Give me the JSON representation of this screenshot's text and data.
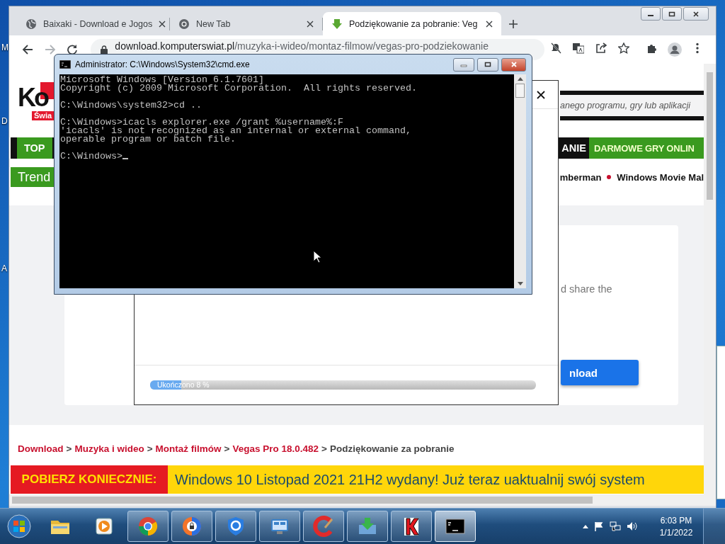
{
  "desktop": {
    "icon_labels": [
      "M",
      "D",
      "A"
    ]
  },
  "browser": {
    "tabs": [
      {
        "title": "Baixaki - Download e Jogos",
        "kind": "globe",
        "selected": false
      },
      {
        "title": "New Tab",
        "kind": "chrome",
        "selected": false
      },
      {
        "title": "Podziękowanie za pobranie: Veg",
        "kind": "download",
        "selected": true
      }
    ],
    "address": {
      "domain": "download.komputerswiat.pl",
      "path": "/muzyka-i-wideo/montaz-filmow/vegas-pro-podziekowanie"
    },
    "page": {
      "logo": {
        "text": "Ko",
        "subtext": "Świa"
      },
      "search_hint": "anego programu, gry lub aplikacji",
      "nav": [
        {
          "label": "TOP",
          "kind": "green"
        },
        {
          "label": "ANIE",
          "kind": "dark"
        },
        {
          "label": "DARMOWE GRY ONLIN",
          "kind": "green"
        }
      ],
      "trending": {
        "label": "Trend",
        "items": [
          "mberman",
          "Windows Movie Mal"
        ]
      },
      "card": {
        "text": "d share the",
        "button": "nload"
      },
      "breadcrumb": [
        {
          "label": "Download",
          "kind": "link"
        },
        {
          "label": ">",
          "kind": "separator"
        },
        {
          "label": "Muzyka i wideo",
          "kind": "link"
        },
        {
          "label": ">",
          "kind": "separator"
        },
        {
          "label": "Montaż filmów",
          "kind": "link"
        },
        {
          "label": ">",
          "kind": "separator"
        },
        {
          "label": "Vegas Pro 18.0.482",
          "kind": "link"
        },
        {
          "label": ">",
          "kind": "separator"
        },
        {
          "label": "Podziękowanie za pobranie",
          "kind": "current"
        }
      ],
      "banner": {
        "label": "POBIERZ KONIECZNIE:",
        "text": "Windows 10 Listopad 2021 21H2 wydany! Już teraz uaktualnij swój system"
      }
    }
  },
  "dialog": {
    "progress": {
      "label": "Ukończono 8 %",
      "level": 0.08
    }
  },
  "cmd": {
    "title": "Administrator: C:\\Windows\\System32\\cmd.exe",
    "blocks": [
      [
        "Microsoft Windows [Version 6.1.7601]",
        "Copyright (c) 2009 Microsoft Corporation.  All rights reserved."
      ],
      [
        "C:\\Windows\\system32>cd .."
      ],
      [
        "C:\\Windows>icacls explorer.exe /grant %username%:F",
        "'icacls' is not recognized as an internal or external command,",
        "operable program or batch file."
      ],
      [
        "C:\\Windows>"
      ]
    ]
  },
  "taskbar": {
    "apps": [
      {
        "kind": "folder",
        "open": false,
        "selected": false
      },
      {
        "kind": "media",
        "open": false,
        "selected": false
      },
      {
        "kind": "chrome",
        "open": true,
        "selected": false
      },
      {
        "kind": "lockbrowser",
        "open": true,
        "selected": false
      },
      {
        "kind": "shield",
        "open": true,
        "selected": false
      },
      {
        "kind": "panel",
        "open": true,
        "selected": false
      },
      {
        "kind": "cleaner",
        "open": true,
        "selected": false
      },
      {
        "kind": "installer",
        "open": true,
        "selected": false
      },
      {
        "kind": "k",
        "open": true,
        "selected": false
      },
      {
        "kind": "console",
        "open": true,
        "selected": true
      }
    ],
    "clock": {
      "time": "6:03 PM",
      "date": "1/1/2022"
    }
  }
}
